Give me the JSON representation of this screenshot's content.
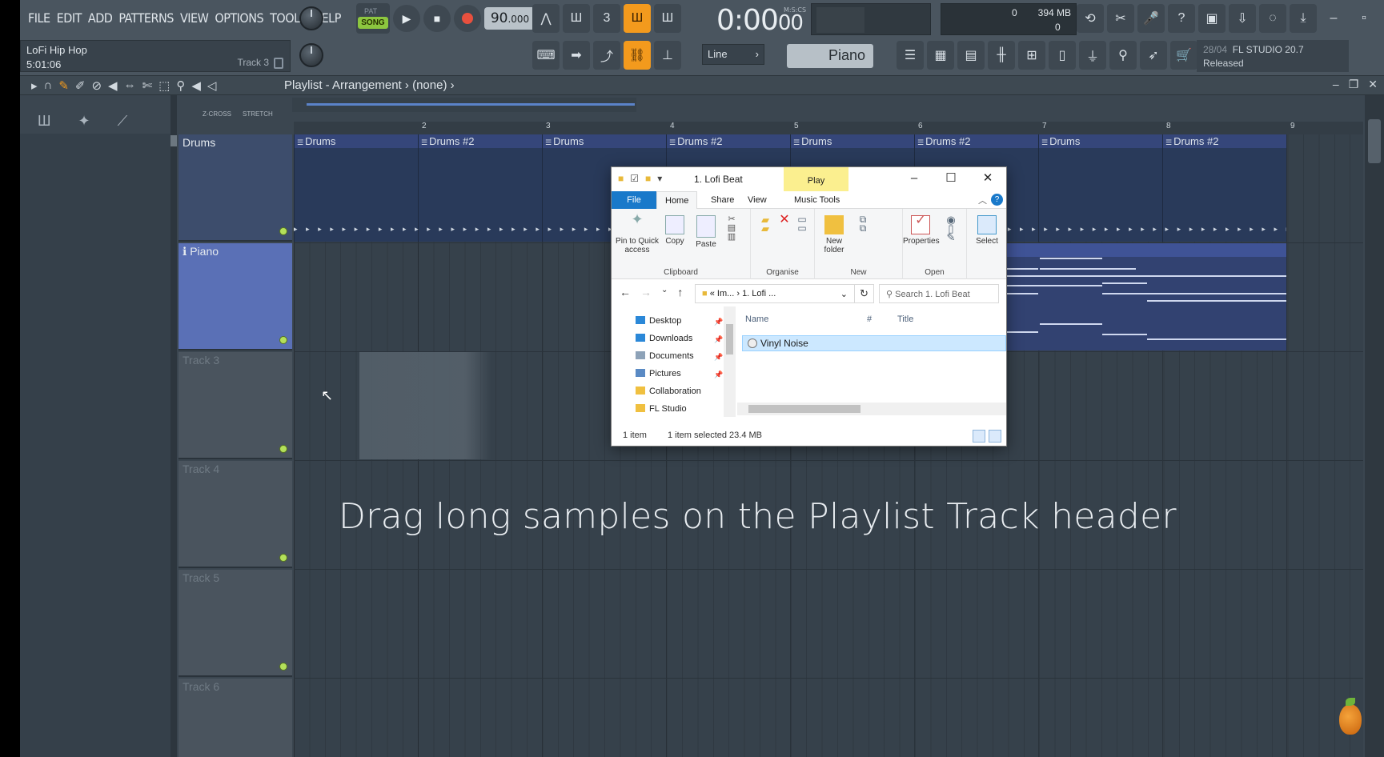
{
  "menu": [
    "FILE",
    "EDIT",
    "ADD",
    "PATTERNS",
    "VIEW",
    "OPTIONS",
    "TOOLS",
    "HELP"
  ],
  "song": {
    "name": "LoFi Hip Hop",
    "time": "5:01:06",
    "track_hint": "Track 3"
  },
  "transport": {
    "pat": "PAT",
    "song": "SONG",
    "tempo_main": "90",
    "tempo_frac": ".000"
  },
  "clock": {
    "value": "0:00",
    "sub": "00",
    "mcs": "M:S:CS"
  },
  "cpu": {
    "v1": "0",
    "mem": "394 MB",
    "v3": "0"
  },
  "snap": "Line",
  "channel": "Piano",
  "version": {
    "date": "28/04",
    "name": "FL STUDIO 20.7",
    "status": "Released"
  },
  "playlist": {
    "title": "Playlist - Arrangement",
    "pattern": "(none)",
    "xcross": "Z-CROSS",
    "stretch": "STRETCH",
    "ruler": [
      "2",
      "3",
      "4",
      "5",
      "6",
      "7",
      "8",
      "9"
    ]
  },
  "tracks": [
    {
      "name": "Drums"
    },
    {
      "name": "Piano"
    },
    {
      "name": "Track 3"
    },
    {
      "name": "Track 4"
    },
    {
      "name": "Track 5"
    },
    {
      "name": "Track 6"
    }
  ],
  "clips": [
    "Drums",
    "Drums #2",
    "Drums",
    "Drums #2",
    "Drums",
    "Drums #2",
    "Drums",
    "Drums #2"
  ],
  "caption": "Drag long samples on the Playlist Track header",
  "explorer": {
    "title": "1. Lofi Beat",
    "contextual_tab": "Play",
    "tabs": {
      "file": "File",
      "home": "Home",
      "share": "Share",
      "view": "View",
      "music": "Music Tools"
    },
    "ribbon": {
      "pin": "Pin to Quick access",
      "copy": "Copy",
      "paste": "Paste",
      "clipboard": "Clipboard",
      "organise": "Organise",
      "new_folder": "New folder",
      "new": "New",
      "properties": "Properties",
      "open": "Open",
      "select": "Select"
    },
    "address": {
      "part1": "Im...",
      "part2": "1. Lofi ...",
      "search_placeholder": "Search 1. Lofi Beat"
    },
    "nav": [
      "Desktop",
      "Downloads",
      "Documents",
      "Pictures",
      "Collaboration",
      "FL Studio"
    ],
    "columns": {
      "name": "Name",
      "num": "#",
      "title": "Title"
    },
    "file": "Vinyl Noise",
    "status": {
      "count": "1 item",
      "selected": "1 item selected  23.4 MB"
    }
  }
}
